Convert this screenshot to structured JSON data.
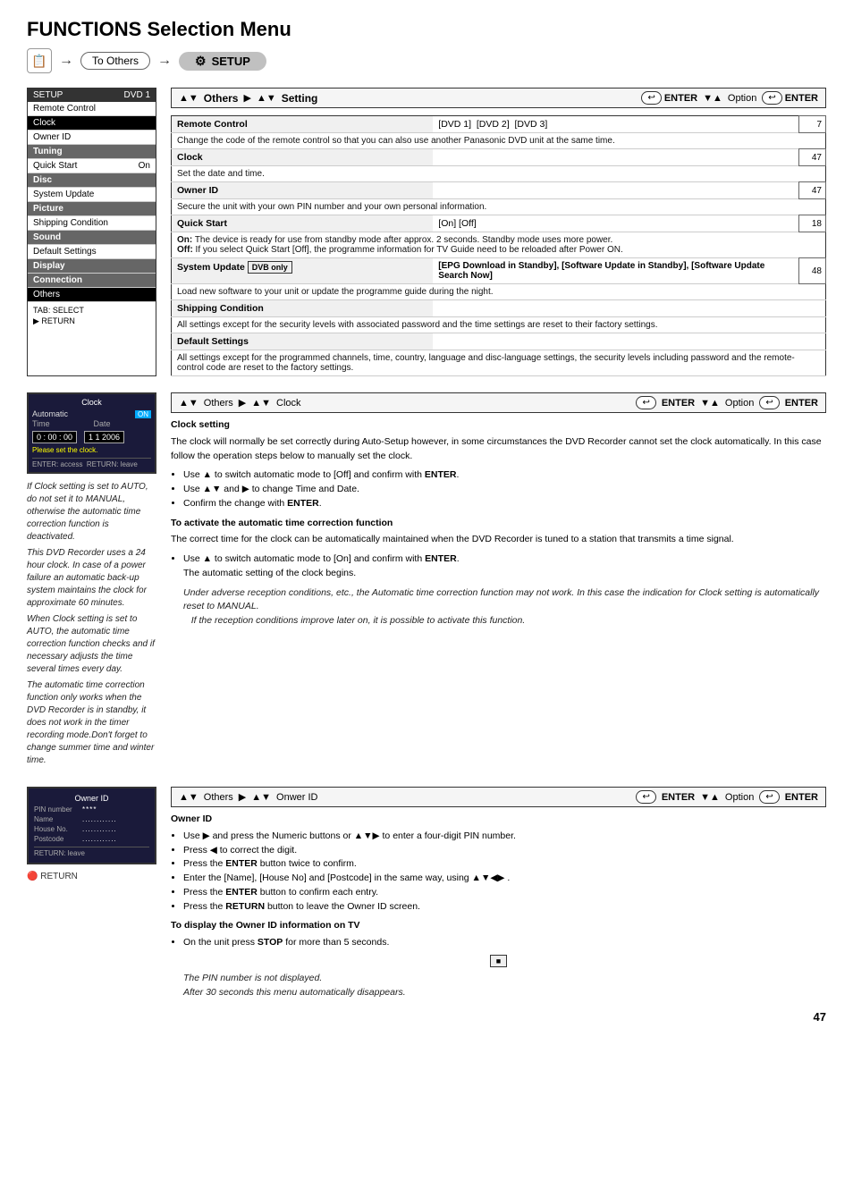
{
  "title": "FUNCTIONS Selection Menu",
  "breadcrumb": {
    "icon": "📋",
    "to_others": "To Others",
    "arrow1": "→",
    "arrow2": "→",
    "setup_icon": "⚙",
    "setup_label": "SETUP"
  },
  "setup_menu": {
    "header_label": "SETUP",
    "header_right": "DVD 1",
    "items": [
      {
        "label": "Remote Control",
        "type": "normal"
      },
      {
        "label": "Clock",
        "type": "active"
      },
      {
        "label": "Owner ID",
        "type": "normal"
      },
      {
        "label": "Tuning",
        "type": "section"
      },
      {
        "label": "Quick Start",
        "type": "on",
        "value": "On"
      },
      {
        "label": "Disc",
        "type": "section"
      },
      {
        "label": "System Update",
        "type": "normal"
      },
      {
        "label": "Picture",
        "type": "section"
      },
      {
        "label": "Shipping Condition",
        "type": "normal"
      },
      {
        "label": "Sound",
        "type": "section"
      },
      {
        "label": "Default Settings",
        "type": "normal"
      },
      {
        "label": "Display",
        "type": "section"
      },
      {
        "label": "Connection",
        "type": "section"
      },
      {
        "label": "Others",
        "type": "highlighted"
      }
    ],
    "nav_hint": "TAB: SELECT",
    "nav_hint2": "▶ RETURN"
  },
  "nav_bar_1": {
    "arrows": "▲▼",
    "label1": "Others",
    "arrow_right": "▶",
    "arrows2": "▲▼",
    "label2": "Setting",
    "enter_icon1": "↩",
    "enter_label1": "ENTER",
    "va_arrows": "▼▲",
    "option_label": "Option",
    "enter_icon2": "↩",
    "enter_label2": "ENTER"
  },
  "settings_rows": [
    {
      "header": "Remote Control",
      "value": "[DVD 1]  [DVD 2]  [DVD 3]",
      "desc": "Change the code of the remote control so that you can also use another Panasonic DVD unit at the same time.",
      "number": "7"
    },
    {
      "header": "Clock",
      "value": "",
      "desc": "Set the date and time.",
      "number": "47"
    },
    {
      "header": "Owner ID",
      "value": "",
      "desc": "Secure the unit with your own PIN number and your own personal information.",
      "number": "47"
    },
    {
      "header": "Quick Start",
      "value": "[On] [Off]",
      "desc_bold": "On:",
      "desc_on": " The device is ready for use from standby mode after approx. 2 seconds. Standby mode uses more power.",
      "desc_bold2": "Off:",
      "desc_off": " If you select Quick Start [Off], the programme information for TV Guide need to be reloaded after Power ON.",
      "number": "18"
    },
    {
      "header": "System Update",
      "badge": "DVB only",
      "value_multiline": "[EPG Download in Standby], [Software Update in Standby], [Software Update Search Now]",
      "desc": "Load new software to your unit or update the programme guide during the night.",
      "number": "48"
    },
    {
      "header": "Shipping Condition",
      "value": "",
      "desc": "All settings except for the security levels with associated password and the time settings are reset to their factory settings.",
      "number": ""
    },
    {
      "header": "Default Settings",
      "value": "",
      "desc": "All settings except for the programmed channels, time, country, language and disc-language settings, the security levels including password and the remote-control code are reset to the factory settings.",
      "number": ""
    }
  ],
  "clock_section": {
    "nav_bar": {
      "arrows": "▲▼",
      "label1": "Others",
      "arrow_right": "▶",
      "arrows2": "▲▼",
      "label2": "Clock",
      "enter_label1": "ENTER",
      "va_arrows": "▼▲",
      "option_label": "Option",
      "enter_label2": "ENTER"
    },
    "mini_screen": {
      "title": "Clock",
      "auto_label": "Automatic",
      "auto_value": "ON",
      "time_label": "Time",
      "date_label": "Date",
      "time_val": "0 : 00 : 00",
      "date_val": "1 1 2006",
      "nav_enter": "ENTER: access",
      "nav_return": "RETURN: leave",
      "prompt": "Please set the clock."
    },
    "notes": [
      "If Clock setting is set to AUTO, do not set it to MANUAL, otherwise the automatic time correction function is deactivated.",
      "This DVD Recorder uses a 24 hour clock. In case of a power failure an automatic back-up system maintains the clock for approximate 60 minutes.",
      "When Clock setting is set to AUTO, the automatic time correction function checks and if necessary adjusts the time several times every day.",
      "The automatic time correction function only works when the DVD Recorder is in standby, it does not work in the timer recording mode.Don't forget to change summer time and winter time."
    ],
    "header": "Clock setting",
    "intro": "The clock will normally be set correctly during Auto-Setup however, in some circumstances the DVD Recorder cannot set the clock automatically. In this case follow the operation steps below to manually set the clock.",
    "bullets": [
      "Use ▲ to switch automatic mode to [Off] and confirm with ENTER.",
      "Use ▲▼ and ▶ to change Time and Date.",
      "Confirm the change with ENTER."
    ],
    "sub_header": "To activate the automatic time correction function",
    "sub_intro": "The correct time for the clock can be automatically maintained when the DVD Recorder is tuned to a station that transmits a time signal.",
    "sub_bullets": [
      "Use ▲ to switch automatic mode to [On] and confirm with ENTER.\nThe automatic setting of the clock begins."
    ],
    "italic_note": "Under adverse reception conditions, etc., the Automatic time correction function may not work. In this case the indication for Clock setting is automatically reset to MANUAL.\nIf the reception conditions improve later on, it is possible to activate this function."
  },
  "owner_section": {
    "nav_bar": {
      "arrows": "▲▼",
      "label1": "Others",
      "arrow_right": "▶",
      "arrows2": "▲▼",
      "label2": "Onwer ID",
      "enter_label1": "ENTER",
      "va_arrows": "▼▲",
      "option_label": "Option",
      "enter_label2": "ENTER"
    },
    "mini_screen": {
      "title": "Owner ID",
      "fields": [
        {
          "label": "PIN number",
          "value": "****"
        },
        {
          "label": "Name",
          "value": "............"
        },
        {
          "label": "House No.",
          "value": "............"
        },
        {
          "label": "Postcode",
          "value": "............"
        }
      ],
      "nav": "RETURN: leave"
    },
    "header": "Owner ID",
    "bullets": [
      "Use ▶ and press the Numeric buttons or ▲▼▶ to enter a four-digit PIN number.",
      "Press ◀ to correct the digit.",
      "Press the ENTER button twice to confirm.",
      "Enter the [Name], [House No] and [Postcode] in the same way, using ▲▼◀▶ .",
      "Press the ENTER button to confirm each entry.",
      "Press the RETURN button to leave the Owner ID screen."
    ],
    "sub_header": "To display the Owner ID information on TV",
    "sub_bullets": [
      "On the unit press STOP for more than 5 seconds."
    ],
    "italic_note": "The PIN number is not displayed.\nAfter 30 seconds this menu automatically disappears."
  },
  "page_number": "47"
}
